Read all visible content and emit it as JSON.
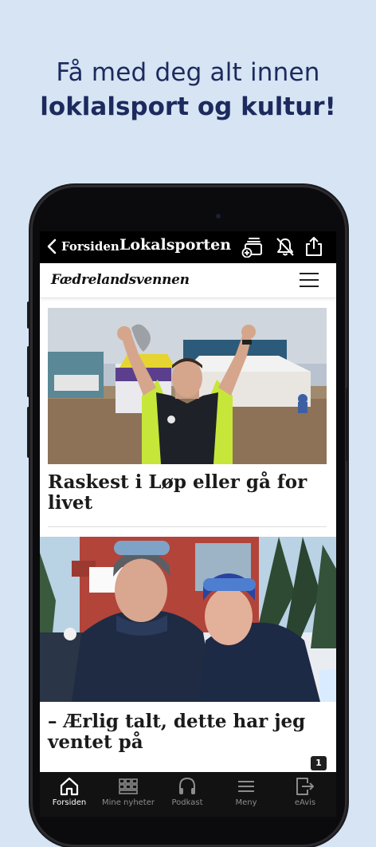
{
  "promo": {
    "line1": "Få med deg alt innen",
    "line2": "loklalsport og kultur!"
  },
  "header": {
    "back_label": "Forsiden",
    "title": "Lokalsporten",
    "icons": [
      "add-stack-icon",
      "bell-off-icon",
      "share-icon"
    ]
  },
  "masthead": {
    "logo": "Fædrelandsvennen",
    "menu_icon": "hamburger-icon"
  },
  "articles": [
    {
      "title": "Raskest i Løp eller gå for livet",
      "image": "runner-celebrating-photo"
    },
    {
      "title": "– Ærlig talt, dette har jeg ventet på",
      "image": "two-skiers-smiling-photo"
    }
  ],
  "badge": "1",
  "tabs": [
    {
      "label": "Forsiden",
      "icon": "home-icon",
      "active": true
    },
    {
      "label": "Mine nyheter",
      "icon": "grid-icon",
      "active": false
    },
    {
      "label": "Podkast",
      "icon": "headphones-icon",
      "active": false
    },
    {
      "label": "Meny",
      "icon": "menu-icon",
      "active": false
    },
    {
      "label": "eAvis",
      "icon": "enavis-icon",
      "active": false
    }
  ],
  "colors": {
    "background": "#d6e4f3",
    "promo_text": "#1d2a5e",
    "tabbar": "#121212"
  }
}
